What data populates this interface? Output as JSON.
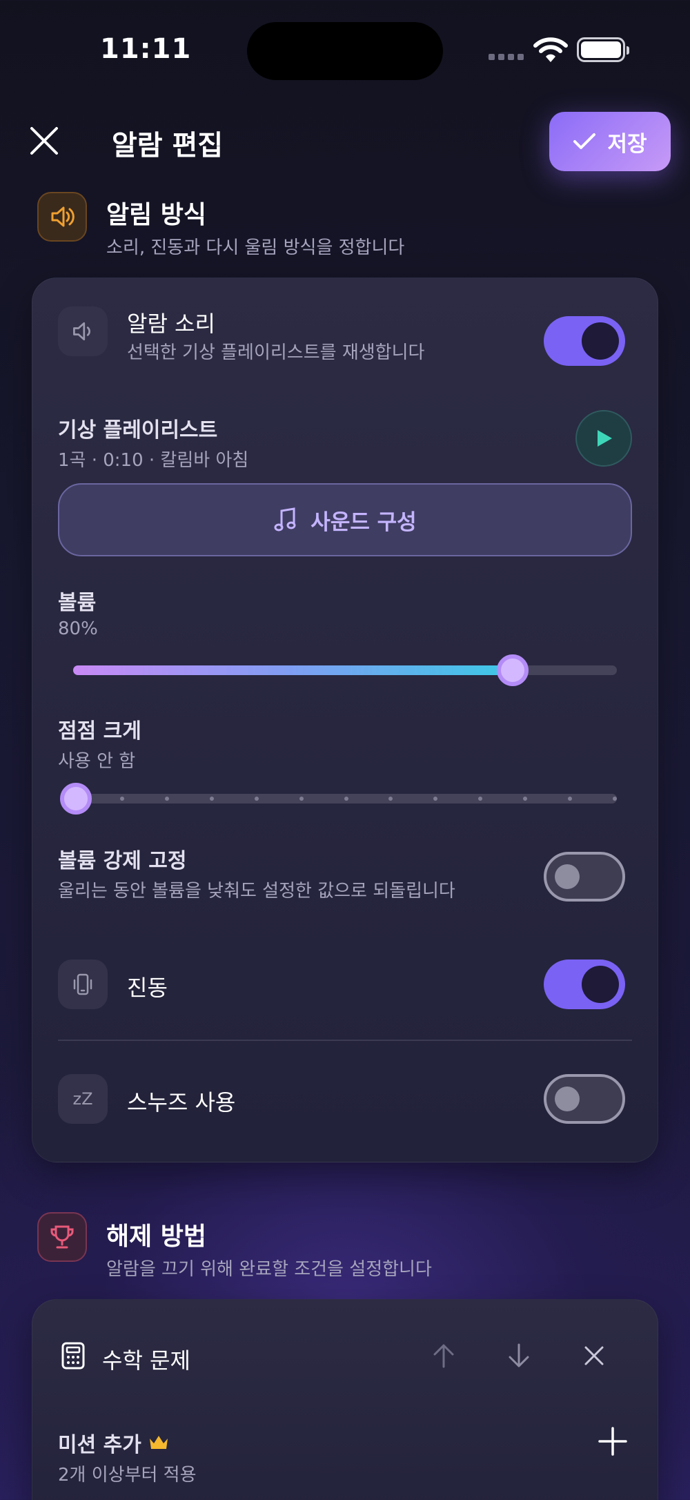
{
  "status_bar": {
    "time": "11:11"
  },
  "header": {
    "title": "알람 편집",
    "save_label": "저장"
  },
  "section_alert": {
    "title": "알림 방식",
    "subtitle": "소리, 진동과 다시 울림 방식을 정합니다",
    "icon": "speaker-icon",
    "icon_color": "#f0a030"
  },
  "alarm_sound": {
    "title": "알람 소리",
    "subtitle": "선택한 기상 플레이리스트를 재생합니다",
    "enabled": true
  },
  "playlist": {
    "title": "기상 플레이리스트",
    "detail": "1곡 · 0:10 · 칼림바 아침"
  },
  "sound_config": {
    "label": "사운드 구성"
  },
  "volume": {
    "label": "볼륨",
    "value_text": "80%",
    "value": 0.8
  },
  "gradual": {
    "label": "점점 크게",
    "value_text": "사용 안 함",
    "value": 0,
    "steps": 12
  },
  "force_volume": {
    "title": "볼륨 강제 고정",
    "subtitle": "울리는 동안 볼륨을 낮춰도 설정한 값으로 되돌립니다",
    "enabled": false
  },
  "vibration": {
    "title": "진동",
    "enabled": true
  },
  "snooze": {
    "title": "스누즈 사용",
    "icon_text": "zZ",
    "enabled": false
  },
  "section_dismiss": {
    "title": "해제 방법",
    "subtitle": "알람을 끄기 위해 완료할 조건을 설정합니다",
    "icon": "trophy-icon",
    "icon_color": "#e85a7a"
  },
  "mission": {
    "title": "수학 문제"
  },
  "add_mission": {
    "title": "미션 추가",
    "subtitle": "2개 이상부터 적용"
  },
  "colors": {
    "accent": "#7a62f4",
    "save_gradient_start": "#8b6cf7",
    "save_gradient_end": "#c79af7",
    "play": "#3ed6b8"
  }
}
